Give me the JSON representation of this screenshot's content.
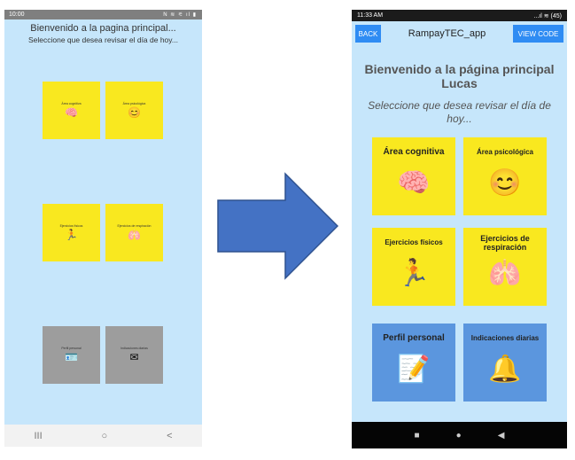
{
  "left": {
    "status_time": "10:00",
    "status_icons": "N ≋ ⚟ ıl ▮",
    "title": "Bienvenido a la pagina principal...",
    "subtitle": "Seleccione que desea revisar el día de hoy...",
    "tiles": [
      {
        "label": "Área cognitiva",
        "icon": "brain-icon"
      },
      {
        "label": "Área psicológica",
        "icon": "emoji-icon"
      },
      {
        "label": "Ejercicios físicos",
        "icon": "runner-icon"
      },
      {
        "label": "Ejercicios de respiración",
        "icon": "lungs-icon"
      },
      {
        "label": "Perfil personal",
        "icon": "id-card-icon"
      },
      {
        "label": "Indicaciones diarias",
        "icon": "envelope-icon"
      }
    ],
    "nav": [
      "III",
      "○",
      "<"
    ]
  },
  "right": {
    "status_time": "11:33 AM",
    "status_icons": "...ıl ≋ (45)",
    "back_label": "BACK",
    "app_title": "RampayTEC_app",
    "view_code_label": "VIEW CODE",
    "title": "Bienvenido a la página principal Lucas",
    "subtitle": "Seleccione que desea revisar el día de hoy...",
    "tiles": [
      {
        "label": "Área cognitiva",
        "icon": "brain-icon"
      },
      {
        "label": "Área psicológica",
        "icon": "emoji-icon"
      },
      {
        "label": "Ejercicios físicos",
        "icon": "runner-icon"
      },
      {
        "label": "Ejercicios de respiración",
        "icon": "lungs-icon"
      },
      {
        "label": "Perfil personal",
        "icon": "profile-form-icon"
      },
      {
        "label": "Indicaciones diarias",
        "icon": "bell-envelope-icon"
      }
    ],
    "nav": [
      "■",
      "●",
      "◀"
    ]
  },
  "colors": {
    "background": "#c6e6fb",
    "tile_yellow": "#f9e81f",
    "tile_gray": "#9d9d9d",
    "tile_blue": "#5b96de",
    "button_blue": "#2f8cf3",
    "arrow": "#4472c4"
  }
}
